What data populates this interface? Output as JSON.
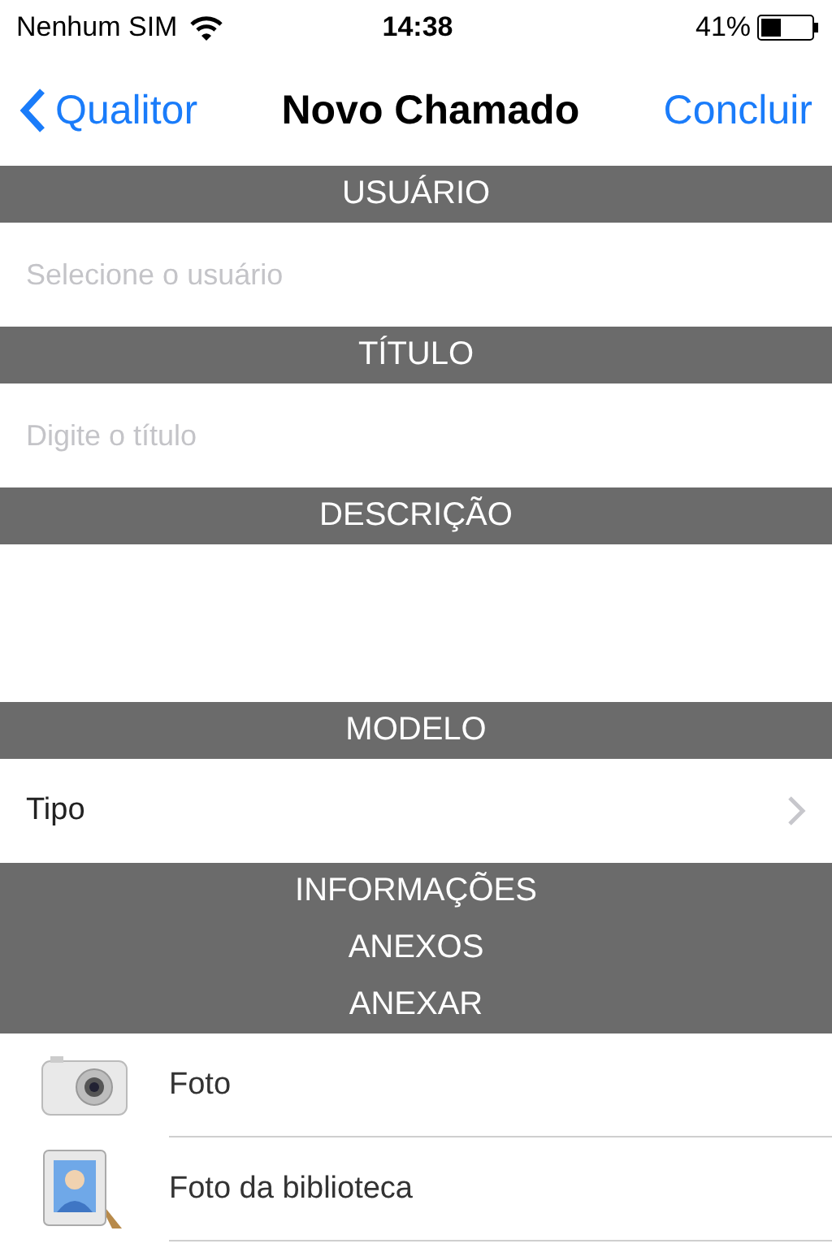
{
  "status_bar": {
    "carrier": "Nenhum SIM",
    "time": "14:38",
    "battery": "41%"
  },
  "nav": {
    "back": "Qualitor",
    "title": "Novo Chamado",
    "action": "Concluir"
  },
  "sections": [
    {
      "kind": "header",
      "label": "USUÁRIO"
    },
    {
      "kind": "field",
      "placeholder": "Selecione o usuário"
    },
    {
      "kind": "header",
      "label": "TÍTULO"
    },
    {
      "kind": "field",
      "placeholder": "Digite o título"
    },
    {
      "kind": "header",
      "label": "DESCRIÇÃO"
    },
    {
      "kind": "textarea"
    },
    {
      "kind": "header",
      "label": "MODELO"
    },
    {
      "kind": "disclosure",
      "label": "Tipo"
    },
    {
      "kind": "header",
      "label": "INFORMAÇÕES"
    },
    {
      "kind": "header",
      "label": "ANEXOS"
    },
    {
      "kind": "header",
      "label": "ANEXAR"
    },
    {
      "kind": "camera",
      "label": "Foto"
    },
    {
      "kind": "library",
      "label": "Foto da biblioteca"
    }
  ]
}
